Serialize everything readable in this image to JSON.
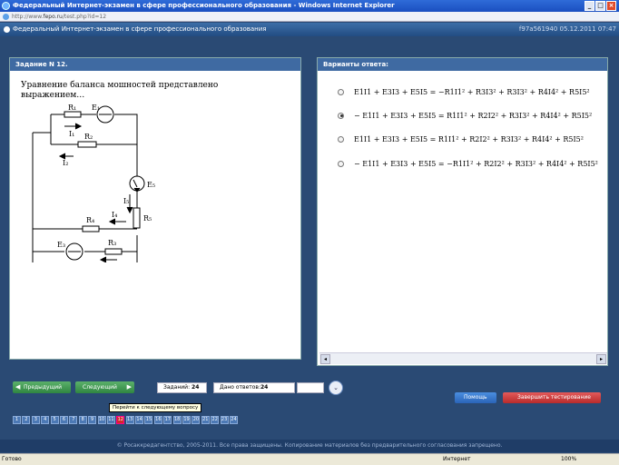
{
  "window": {
    "title": "Федеральный Интернет-экзамен в сфере профессионального образования - Windows Internet Explorer"
  },
  "address": {
    "prefix": "http://www.",
    "domain": "fepo.ru",
    "path": "/test.php?id=12"
  },
  "site": {
    "title": "Федеральный Интернет-экзамен в сфере профессионального образования",
    "session": "f97a561940 05.12.2011 07:47"
  },
  "question": {
    "header": "Задание N 12.",
    "text": "Уравнение баланса мошностей представлено выражением…",
    "diagram_labels": [
      "R1",
      "E1",
      "I1",
      "R2",
      "I2",
      "E5",
      "I5",
      "R5",
      "R4",
      "I4",
      "E3",
      "R3",
      "I3"
    ]
  },
  "answers": {
    "header": "Варианты ответа:",
    "items": [
      {
        "formula": "E1I1 + E3I3 + E5I5 = −R1I1² + R3I3² + R3I3² + R4I4² + R5I5²",
        "selected": false
      },
      {
        "formula": "− E1I1 + E3I3 + E5I5 = R1I1² + R2I2² + R3I3² + R4I4² + R5I5²",
        "selected": true
      },
      {
        "formula": "E1I1 + E3I3 + E5I5 = R1I1² + R2I2² + R3I3² + R4I4² + R5I5²",
        "selected": false
      },
      {
        "formula": "− E1I1 + E3I3 + E5I5 = −R1I1² + R2I2² + R3I3² + R4I4² + R5I5²",
        "selected": false
      }
    ]
  },
  "nav": {
    "prev_label": "Предыдущий",
    "next_label": "Следующий",
    "tasks_label": "Заданий:",
    "tasks_value": "24",
    "answered_label": "Дано ответов:",
    "answered_value": "24",
    "tooltip": "Перейти к следующему вопросу",
    "help_label": "Помощь",
    "finish_label": "Завершить тестирование",
    "pages": [
      "1",
      "2",
      "3",
      "4",
      "5",
      "6",
      "7",
      "8",
      "9",
      "10",
      "11",
      "12",
      "13",
      "14",
      "15",
      "16",
      "17",
      "18",
      "19",
      "20",
      "21",
      "22",
      "23",
      "24"
    ],
    "current_page": "12"
  },
  "footer": {
    "text": "© Росаккредагентство, 2005-2011. Все права защищены. Копирование материалов без предварительного согласования запрещено."
  },
  "status": {
    "left": "Готово",
    "zone": "Интернет",
    "zoom": "100%"
  },
  "colors": {
    "accent": "#3f6aa2",
    "next_green": "#2f8641",
    "finish_red": "#b82b2b",
    "current_page": "#d32a2a"
  }
}
